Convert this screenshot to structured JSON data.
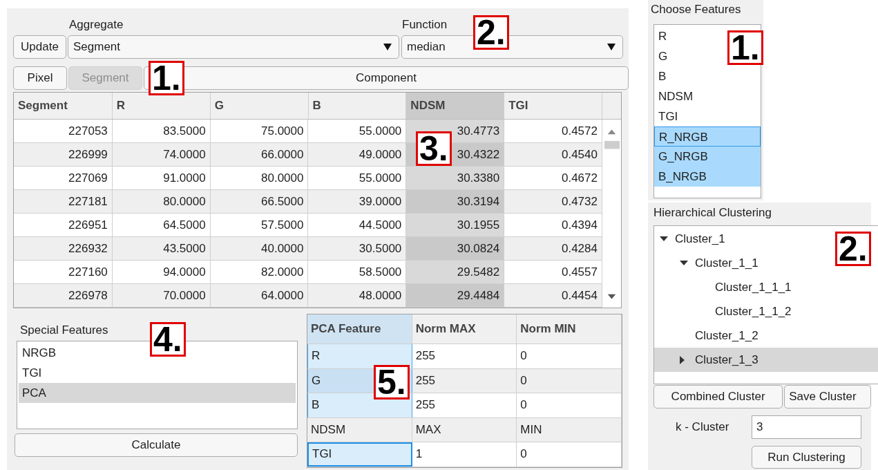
{
  "aggregation": {
    "aggregate_label": "Aggregate",
    "function_label": "Function",
    "update_button": "Update",
    "aggregate_value": "Segment",
    "function_value": "median",
    "callout": "2."
  },
  "view_tabs": {
    "tabs": [
      {
        "label": "Pixel",
        "selected": false
      },
      {
        "label": "Segment",
        "selected": true
      },
      {
        "label": "Component",
        "selected": false
      }
    ],
    "callout": "1."
  },
  "data_table": {
    "columns": [
      {
        "label": "Segment",
        "selected": false
      },
      {
        "label": "R",
        "selected": false
      },
      {
        "label": "G",
        "selected": false
      },
      {
        "label": "B",
        "selected": false
      },
      {
        "label": "NDSM",
        "selected": true
      },
      {
        "label": "TGI",
        "selected": false
      }
    ],
    "rows": [
      [
        "227053",
        "83.5000",
        "75.0000",
        "55.0000",
        "30.4773",
        "0.4572"
      ],
      [
        "226999",
        "74.0000",
        "66.0000",
        "49.0000",
        "30.4322",
        "0.4540"
      ],
      [
        "227069",
        "91.0000",
        "80.0000",
        "55.0000",
        "30.3380",
        "0.4672"
      ],
      [
        "227181",
        "80.0000",
        "66.5000",
        "39.0000",
        "30.3194",
        "0.4732"
      ],
      [
        "226951",
        "64.5000",
        "57.5000",
        "44.5000",
        "30.1955",
        "0.4394"
      ],
      [
        "226932",
        "43.5000",
        "40.0000",
        "30.5000",
        "30.0824",
        "0.4284"
      ],
      [
        "227160",
        "94.0000",
        "82.0000",
        "58.5000",
        "29.5482",
        "0.4557"
      ],
      [
        "226978",
        "70.0000",
        "64.0000",
        "48.0000",
        "29.4484",
        "0.4454"
      ]
    ],
    "callout": "3."
  },
  "special_features": {
    "title": "Special Features",
    "items": [
      {
        "label": "NRGB",
        "selected": false
      },
      {
        "label": "TGI",
        "selected": false
      },
      {
        "label": "PCA",
        "selected": true
      }
    ],
    "button": "Calculate",
    "callout": "4."
  },
  "pca_table": {
    "columns": [
      "PCA Feature",
      "Norm MAX",
      "Norm MIN"
    ],
    "rows": [
      {
        "cells": [
          "R",
          "255",
          "0"
        ],
        "selected": true,
        "focused": false
      },
      {
        "cells": [
          "G",
          "255",
          "0"
        ],
        "selected": true,
        "focused": false
      },
      {
        "cells": [
          "B",
          "255",
          "0"
        ],
        "selected": true,
        "focused": false
      },
      {
        "cells": [
          "NDSM",
          "MAX",
          "MIN"
        ],
        "selected": false,
        "focused": false
      },
      {
        "cells": [
          "TGI",
          "1",
          "0"
        ],
        "selected": true,
        "focused": true
      }
    ],
    "callout": "5."
  },
  "choose_features": {
    "title": "Choose Features",
    "items": [
      {
        "label": "R",
        "selected": false
      },
      {
        "label": "G",
        "selected": false
      },
      {
        "label": "B",
        "selected": false
      },
      {
        "label": "NDSM",
        "selected": false
      },
      {
        "label": "TGI",
        "selected": false
      },
      {
        "label": "R_NRGB",
        "selected": true
      },
      {
        "label": "G_NRGB",
        "selected": true
      },
      {
        "label": "B_NRGB",
        "selected": true
      }
    ],
    "callout": "1."
  },
  "hierarchical_clustering": {
    "title": "Hierarchical Clustering",
    "tree": [
      {
        "label": "Cluster_1",
        "expanded": true,
        "selected": false,
        "children": [
          {
            "label": "Cluster_1_1",
            "expanded": true,
            "selected": false,
            "children": [
              {
                "label": "Cluster_1_1_1",
                "selected": false
              },
              {
                "label": "Cluster_1_1_2",
                "selected": false
              }
            ]
          },
          {
            "label": "Cluster_1_2",
            "selected": false
          },
          {
            "label": "Cluster_1_3",
            "expanded": false,
            "selected": true
          }
        ]
      }
    ],
    "buttons": [
      "Combined Cluster",
      "Save Cluster"
    ],
    "k_label": "k - Cluster",
    "k_value": "3",
    "run_button": "Run Clustering",
    "callout": "2."
  }
}
